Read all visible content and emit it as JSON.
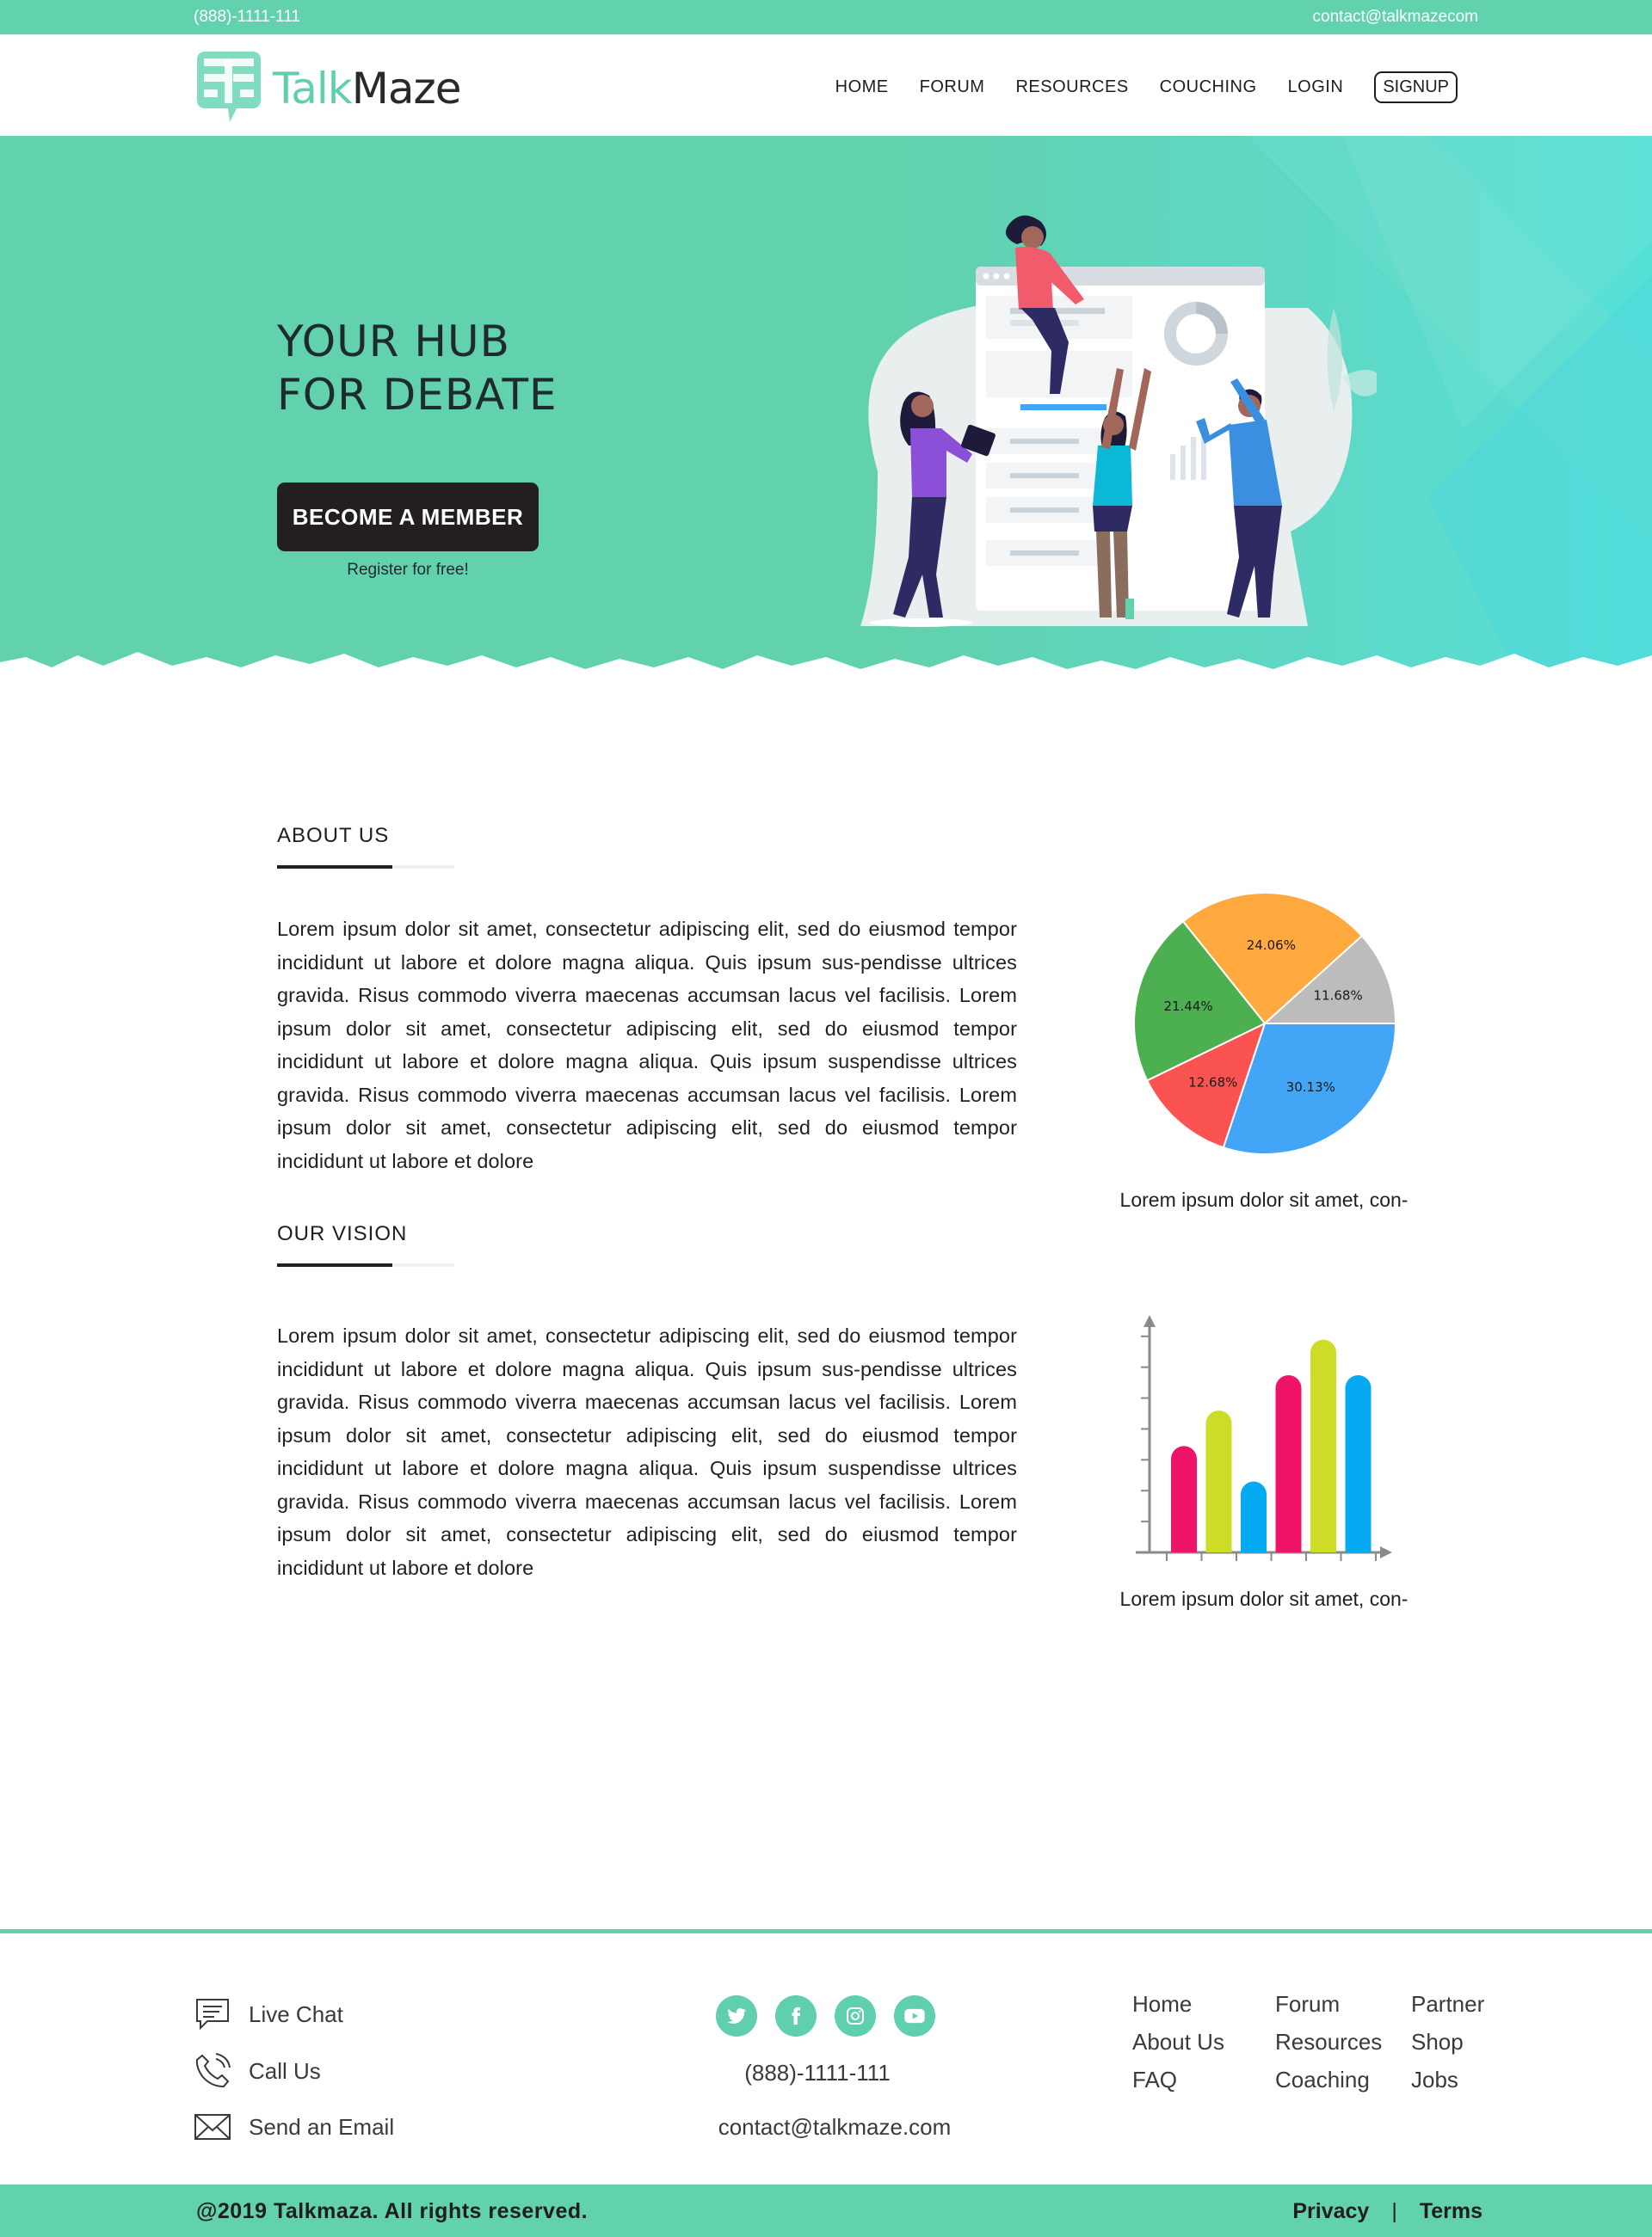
{
  "topbar": {
    "phone": "(888)-1111-111",
    "email": "contact@talkmazecom"
  },
  "brand": {
    "word1": "Talk",
    "word2": "Maze",
    "color": "#5fcfb0"
  },
  "nav": {
    "home": "HOME",
    "forum": "FORUM",
    "resources": "RESOURCES",
    "couching": "COUCHING",
    "login": "LOGIN",
    "signup": "SIGNUP"
  },
  "hero": {
    "title_line1": "YOUR HUB",
    "title_line2": "FOR DEBATE",
    "cta": "BECOME A MEMBER",
    "cta_sub": "Register for free!",
    "bg_color": "#61d1ae"
  },
  "about": {
    "heading": "ABOUT US",
    "text": "Lorem ipsum dolor sit amet, consectetur adipiscing elit, sed do eiusmod tempor incididunt ut labore et dolore magna aliqua. Quis ipsum sus-pendisse ultrices gravida. Risus commodo viverra maecenas accumsan lacus vel facilisis. Lorem ipsum dolor sit amet, consectetur adipiscing elit, sed do eiusmod tempor incididunt ut labore et dolore magna aliqua. Quis ipsum suspendisse ultrices gravida. Risus commodo viverra maecenas accumsan lacus vel facilisis. Lorem ipsum dolor sit amet, consectetur adipiscing elit, sed do eiusmod tempor incididunt ut labore et dolore",
    "caption": "Lorem ipsum dolor sit amet, con-"
  },
  "vision": {
    "heading": "OUR VISION",
    "text": "Lorem ipsum dolor sit amet, consectetur adipiscing elit, sed do eiusmod tempor incididunt ut labore et dolore magna aliqua. Quis ipsum sus-pendisse ultrices gravida. Risus commodo viverra maecenas accumsan lacus vel facilisis. Lorem ipsum dolor sit amet, consectetur adipiscing elit, sed do eiusmod tempor incididunt ut labore et dolore magna aliqua. Quis ipsum suspendisse ultrices gravida. Risus commodo viverra maecenas accumsan lacus vel facilisis. Lorem ipsum dolor sit amet, consectetur adipiscing elit, sed do eiusmod tempor incididunt ut labore et dolore",
    "caption": "Lorem ipsum dolor sit amet, con-"
  },
  "chart_data": [
    {
      "type": "pie",
      "slices": [
        {
          "label": "24.06%",
          "value": 24.06,
          "color": "#ffa93f"
        },
        {
          "label": "11.68%",
          "value": 11.68,
          "color": "#bcbcbc"
        },
        {
          "label": "30.13%",
          "value": 30.13,
          "color": "#42a5f5"
        },
        {
          "label": "12.68%",
          "value": 12.68,
          "color": "#fb5352"
        },
        {
          "label": "21.44%",
          "value": 21.44,
          "color": "#4caf50"
        }
      ]
    },
    {
      "type": "bar",
      "values": [
        3,
        4,
        2,
        5,
        6,
        5
      ],
      "colors": [
        "#ef1467",
        "#cddc27",
        "#06aaf2",
        "#ef1467",
        "#cddc27",
        "#06aaf2"
      ],
      "ylim": [
        0,
        6.6
      ],
      "y_ticks": 7,
      "x_ticks": 7
    }
  ],
  "footer": {
    "live_chat": "Live Chat",
    "call_us": "Call Us",
    "send_email": "Send an Email",
    "phone": "(888)-1111-111",
    "email": "contact@talkmaze.com",
    "links_col1": [
      "Home",
      "About Us",
      "FAQ"
    ],
    "links_col2": [
      "Forum",
      "Resources",
      "Coaching"
    ],
    "links_col3": [
      "Partner",
      "Shop",
      "Jobs"
    ],
    "copyright": "@2019 Talkmaza. All rights reserved.",
    "privacy": "Privacy",
    "separator": "|",
    "terms": "Terms"
  }
}
